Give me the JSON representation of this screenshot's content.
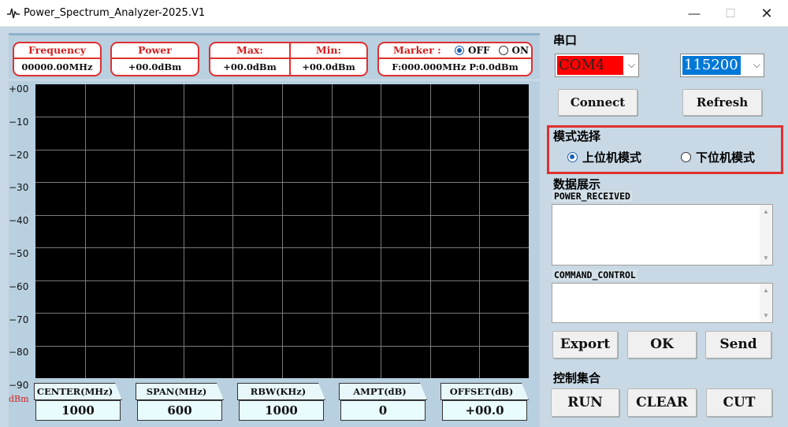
{
  "window": {
    "title": "Power_Spectrum_Analyzer-2025.V1"
  },
  "indicators": {
    "frequency": {
      "label": "Frequency",
      "value": "00000.00MHz"
    },
    "power": {
      "label": "Power",
      "value": "+00.0dBm"
    },
    "max": {
      "label": "Max:",
      "value": "+00.0dBm"
    },
    "min": {
      "label": "Min:",
      "value": "+00.0dBm"
    },
    "marker": {
      "label": "Marker :",
      "off": "OFF",
      "on": "ON",
      "selected": "OFF",
      "value": "F:000.000MHz P:0.0dBm"
    }
  },
  "plot": {
    "y_ticks": [
      "+00",
      "−10",
      "−20",
      "−30",
      "−40",
      "−50",
      "−60",
      "−70",
      "−80",
      "−90"
    ],
    "unit": "dBm"
  },
  "params": [
    {
      "label": "CENTER(MHz)",
      "value": "1000"
    },
    {
      "label": "SPAN(MHz)",
      "value": "600"
    },
    {
      "label": "RBW(KHz)",
      "value": "1000"
    },
    {
      "label": "AMPT(dB)",
      "value": "0"
    },
    {
      "label": "OFFSET(dB)",
      "value": "+00.0"
    }
  ],
  "serial": {
    "title": "串口",
    "port": "COM4",
    "baud": "115200",
    "connect": "Connect",
    "refresh": "Refresh"
  },
  "mode": {
    "title": "模式选择",
    "upper": "上位机模式",
    "lower": "下位机模式",
    "selected": "上位机模式"
  },
  "data_display": {
    "title": "数据展示",
    "power_received_label": "POWER_RECEIVED",
    "command_control_label": "COMMAND_CONTROL",
    "export": "Export",
    "ok": "OK",
    "send": "Send"
  },
  "control": {
    "title": "控制集合",
    "run": "RUN",
    "clear": "CLEAR",
    "cut": "CUT"
  },
  "colors": {
    "accent_red": "#e03030",
    "port_highlight": "#ff0000",
    "baud_highlight": "#0078d7",
    "plot_bg": "#000000",
    "grid": "#7a7a7a"
  }
}
